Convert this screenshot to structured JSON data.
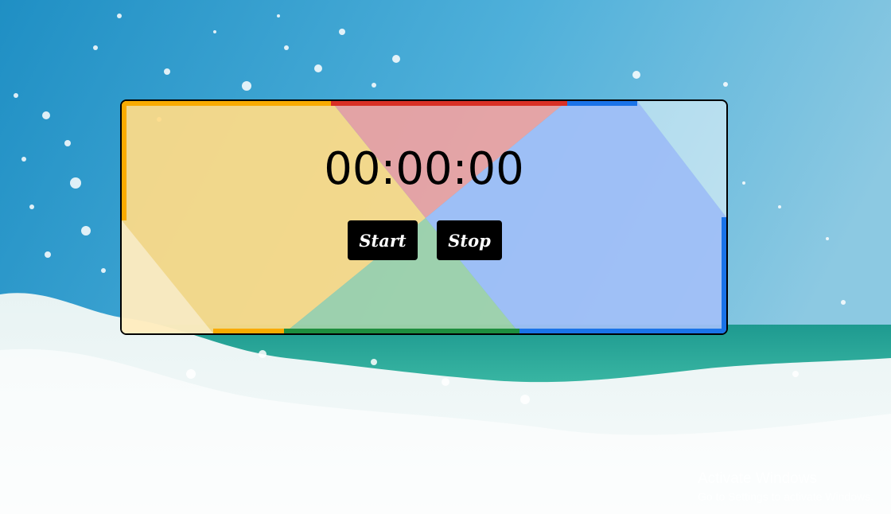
{
  "stopwatch": {
    "time": "00:00:00",
    "start_label": "Start",
    "stop_label": "Stop"
  },
  "watermark": {
    "title": "Activate Windows",
    "subtitle": "Go to Settings to activate Windows."
  },
  "colors": {
    "yellow": "#FFDC87",
    "red": "#EFA3A1",
    "green": "#A2D3AA",
    "blue": "#A3BFF7",
    "button": "#000000"
  }
}
